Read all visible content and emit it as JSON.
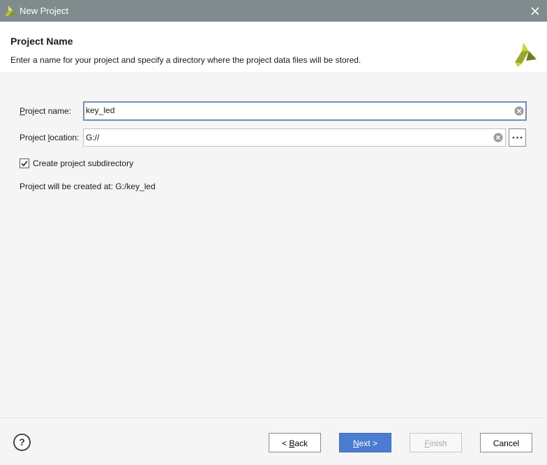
{
  "window": {
    "title": "New Project"
  },
  "header": {
    "title": "Project Name",
    "description": "Enter a name for your project and specify a directory where the project data files will be stored."
  },
  "form": {
    "project_name": {
      "label": "Project name:",
      "label_mnemonic": "P",
      "label_rest": "roject name:",
      "value": "key_led"
    },
    "project_location": {
      "label": "Project location:",
      "label_pre": "Project ",
      "label_mnemonic": "l",
      "label_rest": "ocation:",
      "value": "G://"
    },
    "create_subdirectory": {
      "label": "Create project subdirectory",
      "checked": true
    },
    "created_at": "Project will be created at: G:/key_led"
  },
  "footer": {
    "help_label": "?",
    "back": {
      "label": "< Back",
      "pre": "< ",
      "mnemonic": "B",
      "rest": "ack"
    },
    "next": {
      "label": "Next >",
      "mnemonic": "N",
      "rest": "ext >"
    },
    "finish": {
      "label": "Finish",
      "mnemonic": "F",
      "rest": "inish"
    },
    "cancel": {
      "label": "Cancel"
    }
  },
  "icons": {
    "app": "app-logo-icon",
    "close": "close-icon",
    "clear": "clear-input-icon",
    "browse": "ellipsis-icon",
    "help": "help-icon",
    "check": "checkmark-icon"
  },
  "colors": {
    "titlebar": "#7f8b8c",
    "primary": "#4b7ccf",
    "logo_light": "#c9d63a",
    "logo_dark": "#6e7a1f"
  }
}
